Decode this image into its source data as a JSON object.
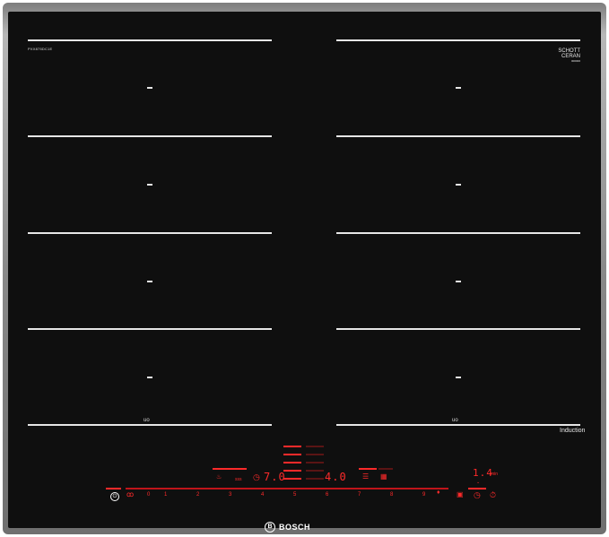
{
  "model_label": "PXX875DC1E",
  "brand_badge": {
    "line1": "SCHOTT",
    "line2": "CERAN",
    "line3": "000000"
  },
  "induction_label": "Induction",
  "flex_labels": [
    "uo",
    "uo"
  ],
  "controls": {
    "timer_label": "min",
    "left_display": "7.0",
    "right_display": "4.0",
    "timer_display": "1.4",
    "slider_values": [
      "0",
      "1",
      "2",
      "3",
      "4",
      "5",
      "6",
      "7",
      "8",
      "9"
    ],
    "icon_labels": {
      "left_label": "ss",
      "small_left": "∿",
      "small_left2": "sss"
    }
  },
  "brand_logo": {
    "text": "BOSCH",
    "mark": "B"
  },
  "colors": {
    "glass": "#0f0f0f",
    "indicator": "#ff2a2a",
    "frame": "#8a8a8a"
  }
}
